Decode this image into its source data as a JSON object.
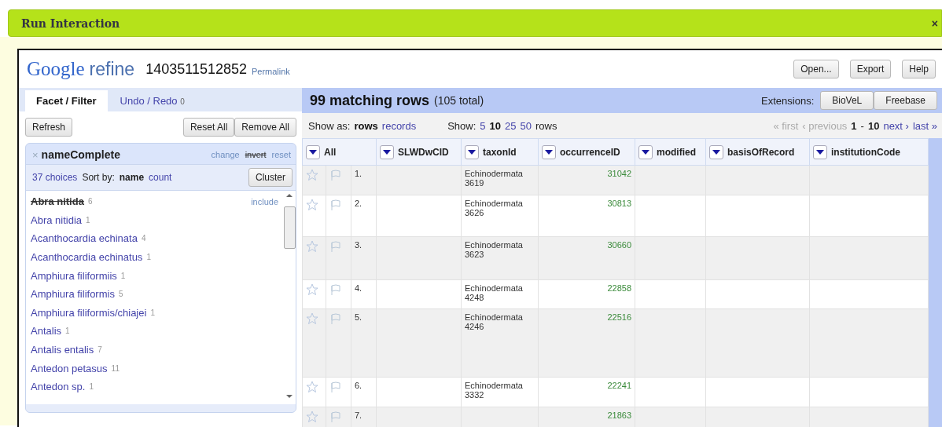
{
  "dialog": {
    "title": "Run Interaction",
    "close": "×"
  },
  "app": {
    "logo_google": "Google",
    "logo_refine": "refine",
    "project_id": "1403511512852",
    "permalink": "Permalink",
    "buttons": [
      "Open...",
      "Export",
      "Help"
    ]
  },
  "left_tabs": [
    {
      "label": "Facet / Filter",
      "selected": true
    },
    {
      "label": "Undo / Redo",
      "selected": false,
      "count": "0"
    }
  ],
  "facet_buttons": {
    "refresh": "Refresh",
    "reset_all": "Reset All",
    "remove_all": "Remove All"
  },
  "facet": {
    "remove": "×",
    "title": "nameComplete",
    "links": [
      {
        "label": "change",
        "struck": false
      },
      {
        "label": "invert",
        "struck": true
      },
      {
        "label": "reset",
        "struck": false
      }
    ],
    "choices": "37 choices",
    "sort_label": "Sort by:",
    "sort": [
      {
        "label": "name",
        "selected": true
      },
      {
        "label": "count",
        "selected": false
      }
    ],
    "cluster": "Cluster",
    "items": [
      {
        "name": "Abra nitida",
        "count": "6",
        "selected": true,
        "action": "include"
      },
      {
        "name": "Abra nitidia",
        "count": "1",
        "selected": false
      },
      {
        "name": "Acanthocardia echinata",
        "count": "4",
        "selected": false
      },
      {
        "name": "Acanthocardia echinatus",
        "count": "1",
        "selected": false
      },
      {
        "name": "Amphiura filiformiis",
        "count": "1",
        "selected": false
      },
      {
        "name": "Amphiura filiformis",
        "count": "5",
        "selected": false
      },
      {
        "name": "Amphiura filiformis/chiajei",
        "count": "1",
        "selected": false
      },
      {
        "name": "Antalis",
        "count": "1",
        "selected": false
      },
      {
        "name": "Antalis entalis",
        "count": "7",
        "selected": false
      },
      {
        "name": "Antedon petasus",
        "count": "11",
        "selected": false
      },
      {
        "name": "Antedon sp.",
        "count": "1",
        "selected": false
      }
    ]
  },
  "summary": {
    "matching": "99 matching rows",
    "total": "(105 total)",
    "extensions_label": "Extensions:",
    "extensions": [
      "BioVeL",
      "Freebase"
    ]
  },
  "view": {
    "show_as_label": "Show as:",
    "show_as": [
      {
        "label": "rows",
        "selected": true
      },
      {
        "label": "records",
        "selected": false
      }
    ],
    "show_label": "Show:",
    "page_sizes": [
      {
        "label": "5",
        "selected": false
      },
      {
        "label": "10",
        "selected": true
      },
      {
        "label": "25",
        "selected": false
      },
      {
        "label": "50",
        "selected": false
      }
    ],
    "rows_label": "rows",
    "pager": [
      {
        "label": "« first",
        "disabled": true
      },
      {
        "label": "‹ previous",
        "disabled": true
      },
      {
        "label": "next ›",
        "disabled": false
      },
      {
        "label": "last »",
        "disabled": false
      }
    ],
    "range_from": "1",
    "range_sep": "-",
    "range_to": "10"
  },
  "table": {
    "columns": [
      "All",
      "SLWDwCID",
      "taxonId",
      "occurrenceID",
      "modified",
      "basisOfRecord",
      "institutionCode"
    ],
    "rows": [
      {
        "index": "1.",
        "starred": false,
        "flagged": false,
        "taxonId": "Echinodermata 3619",
        "occurrenceID": "31042"
      },
      {
        "index": "2.",
        "starred": false,
        "flagged": false,
        "taxonId": "Echinodermata 3626",
        "occurrenceID": "30813"
      },
      {
        "index": "3.",
        "starred": false,
        "flagged": false,
        "taxonId": "Echinodermata 3623",
        "occurrenceID": "30660"
      },
      {
        "index": "4.",
        "starred": false,
        "flagged": false,
        "taxonId": "Echinodermata 4248",
        "occurrenceID": "22858"
      },
      {
        "index": "5.",
        "starred": false,
        "flagged": false,
        "taxonId": "Echinodermata 4246",
        "occurrenceID": "22516"
      },
      {
        "index": "6.",
        "starred": false,
        "flagged": false,
        "taxonId": "Echinodermata 3332",
        "occurrenceID": "22241"
      },
      {
        "index": "7.",
        "starred": false,
        "flagged": false,
        "occurrenceID": "21863"
      }
    ]
  }
}
